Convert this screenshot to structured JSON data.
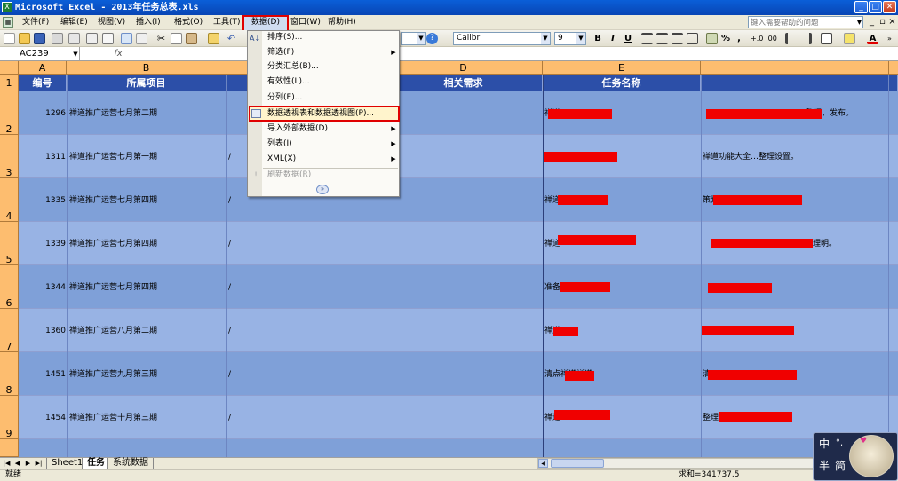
{
  "window": {
    "title": "Microsoft Excel - 2013年任务总表.xls"
  },
  "menu": [
    {
      "label": "文件(F)"
    },
    {
      "label": "编辑(E)"
    },
    {
      "label": "视图(V)"
    },
    {
      "label": "插入(I)"
    },
    {
      "label": "格式(O)"
    },
    {
      "label": "工具(T)"
    },
    {
      "label": "数据(D)"
    },
    {
      "label": "窗口(W)"
    },
    {
      "label": "帮助(H)"
    }
  ],
  "help_search": {
    "placeholder": "键入需要帮助的问题"
  },
  "toolbar": {
    "font_name": "Calibri",
    "font_size": "9",
    "zoom": "",
    "currency": "%",
    "bold": "B",
    "italic": "I",
    "underline": "U",
    "comma": ","
  },
  "formula_bar": {
    "name_box": "AC239",
    "fx": "fx",
    "content": ""
  },
  "column_letters": [
    "A",
    "B",
    "C",
    "D",
    "E",
    ""
  ],
  "header_row": {
    "row_number": "1",
    "cells": [
      "编号",
      "所属项目",
      "",
      "相关需求",
      "任务名称",
      ""
    ]
  },
  "rows": [
    {
      "row_number": "2",
      "id": "1296",
      "project": "禅道推广运营七月第二期",
      "c": "",
      "d": "",
      "e": "禅道",
      "f": "整理，发布。"
    },
    {
      "row_number": "3",
      "id": "1311",
      "project": "禅道推广运营七月第一期",
      "c": "/",
      "d": "",
      "e": "",
      "f": "禅道功能大全…整理设置。"
    },
    {
      "row_number": "4",
      "id": "1335",
      "project": "禅道推广运营七月第四期",
      "c": "/",
      "d": "",
      "e": "禅道",
      "f": "策划"
    },
    {
      "row_number": "5",
      "id": "1339",
      "project": "禅道推广运营七月第四期",
      "c": "/",
      "d": "",
      "e": "禅道",
      "f": "整理明。"
    },
    {
      "row_number": "6",
      "id": "1344",
      "project": "禅道推广运营七月第四期",
      "c": "/",
      "d": "",
      "e": "准备",
      "f": ""
    },
    {
      "row_number": "7",
      "id": "1360",
      "project": "禅道推广运营八月第二期",
      "c": "/",
      "d": "",
      "e": "禅道",
      "f": ""
    },
    {
      "row_number": "8",
      "id": "1451",
      "project": "禅道推广运营九月第三期",
      "c": "/",
      "d": "",
      "e": "清点禅道禅道",
      "f": "清"
    },
    {
      "row_number": "9",
      "id": "1454",
      "project": "禅道推广运营十月第三期",
      "c": "/",
      "d": "",
      "e": "禅道",
      "f": "整理禅道…等。"
    }
  ],
  "data_menu": {
    "items": [
      {
        "label": "排序(S)...",
        "submenu": false,
        "disabled": false
      },
      {
        "label": "筛选(F)",
        "submenu": true,
        "disabled": false
      },
      {
        "label": "分类汇总(B)...",
        "submenu": false,
        "disabled": false
      },
      {
        "label": "有效性(L)...",
        "submenu": false,
        "disabled": false
      },
      {
        "label": "分列(E)...",
        "submenu": false,
        "disabled": false
      },
      {
        "label": "数据透视表和数据透视图(P)...",
        "submenu": false,
        "disabled": false,
        "highlighted": true
      },
      {
        "label": "导入外部数据(D)",
        "submenu": true,
        "disabled": false
      },
      {
        "label": "列表(I)",
        "submenu": true,
        "disabled": false
      },
      {
        "label": "XML(X)",
        "submenu": true,
        "disabled": false
      },
      {
        "label": "刷新数据(R)",
        "submenu": false,
        "disabled": true
      }
    ],
    "expand": "»"
  },
  "sheet_tabs": [
    {
      "label": "Sheet1"
    },
    {
      "label": "任务"
    },
    {
      "label": "系统数据"
    }
  ],
  "status": {
    "ready": "就绪",
    "sum": "求和=341737.5"
  },
  "ime": {
    "lang": "中",
    "punct": "°,",
    "mode": "半",
    "script": "简"
  },
  "colors": {
    "title_bar": "#0a5fd8",
    "header_fill": "#2c4fa8",
    "row_header": "#fdbd6f",
    "highlight_border": "#e00000",
    "redaction": "#f00000"
  }
}
